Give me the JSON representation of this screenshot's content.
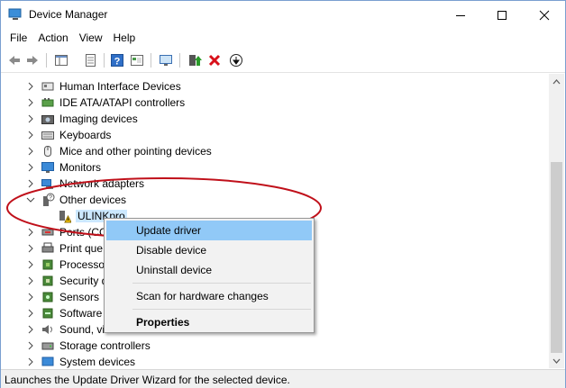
{
  "window": {
    "title": "Device Manager"
  },
  "menu": [
    "File",
    "Action",
    "View",
    "Help"
  ],
  "toolbar": {
    "icons": [
      "back-icon",
      "forward-icon",
      "show-hide-console-tree-icon",
      "properties-icon",
      "help-icon",
      "view-icon",
      "scan-hardware-icon",
      "update-driver-icon",
      "uninstall-icon",
      "enable-device-icon"
    ]
  },
  "tree": {
    "items": [
      {
        "label": "Human Interface Devices",
        "icon": "hid-icon"
      },
      {
        "label": "IDE ATA/ATAPI controllers",
        "icon": "ide-controller-icon"
      },
      {
        "label": "Imaging devices",
        "icon": "camera-icon"
      },
      {
        "label": "Keyboards",
        "icon": "keyboard-icon"
      },
      {
        "label": "Mice and other pointing devices",
        "icon": "mouse-icon"
      },
      {
        "label": "Monitors",
        "icon": "monitor-icon"
      },
      {
        "label": "Network adapters",
        "icon": "network-adapter-icon"
      },
      {
        "label": "Other devices",
        "icon": "unknown-device-icon"
      },
      {
        "label": "ULINKpro",
        "icon": "warning-device-icon"
      },
      {
        "label": "Ports (CC",
        "icon": "port-icon"
      },
      {
        "label": "Print que",
        "icon": "printer-icon"
      },
      {
        "label": "Processor",
        "icon": "processor-icon"
      },
      {
        "label": "Security d",
        "icon": "security-icon"
      },
      {
        "label": "Sensors",
        "icon": "sensor-icon"
      },
      {
        "label": "Software",
        "icon": "software-icon"
      },
      {
        "label": "Sound, vi",
        "icon": "sound-icon"
      },
      {
        "label": "Storage controllers",
        "icon": "storage-icon"
      },
      {
        "label": "System devices",
        "icon": "system-icon"
      }
    ]
  },
  "context_menu": {
    "items": [
      "Update driver",
      "Disable device",
      "Uninstall device",
      "Scan for hardware changes",
      "Properties"
    ]
  },
  "status": {
    "text": "Launches the Update Driver Wizard for the selected device."
  },
  "colors": {
    "highlight": "#91c9f7",
    "selection": "#cce8ff",
    "annotation": "#c0101a"
  }
}
